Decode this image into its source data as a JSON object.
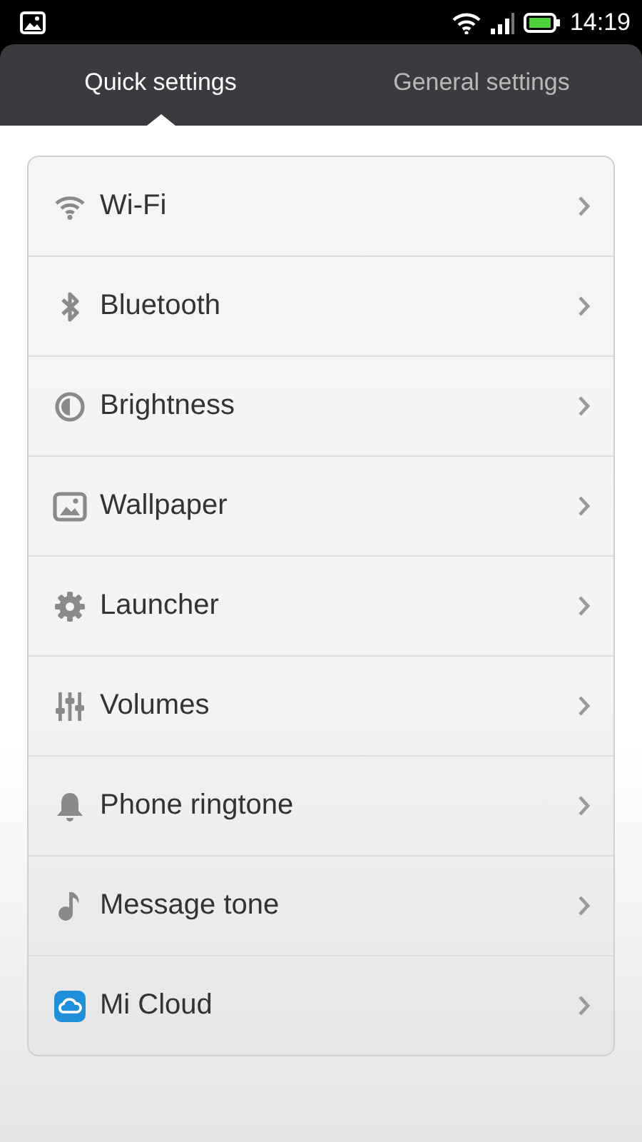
{
  "status_bar": {
    "time": "14:19"
  },
  "tabs": [
    {
      "label": "Quick settings",
      "selected": true
    },
    {
      "label": "General settings",
      "selected": false
    }
  ],
  "items": [
    {
      "kind": "wifi",
      "label": "Wi-Fi"
    },
    {
      "kind": "bluetooth",
      "label": "Bluetooth"
    },
    {
      "kind": "brightness",
      "label": "Brightness"
    },
    {
      "kind": "wallpaper",
      "label": "Wallpaper"
    },
    {
      "kind": "launcher",
      "label": "Launcher"
    },
    {
      "kind": "volumes",
      "label": "Volumes"
    },
    {
      "kind": "ringtone",
      "label": "Phone ringtone"
    },
    {
      "kind": "message",
      "label": "Message tone"
    },
    {
      "kind": "cloud",
      "label": "Mi Cloud"
    }
  ]
}
